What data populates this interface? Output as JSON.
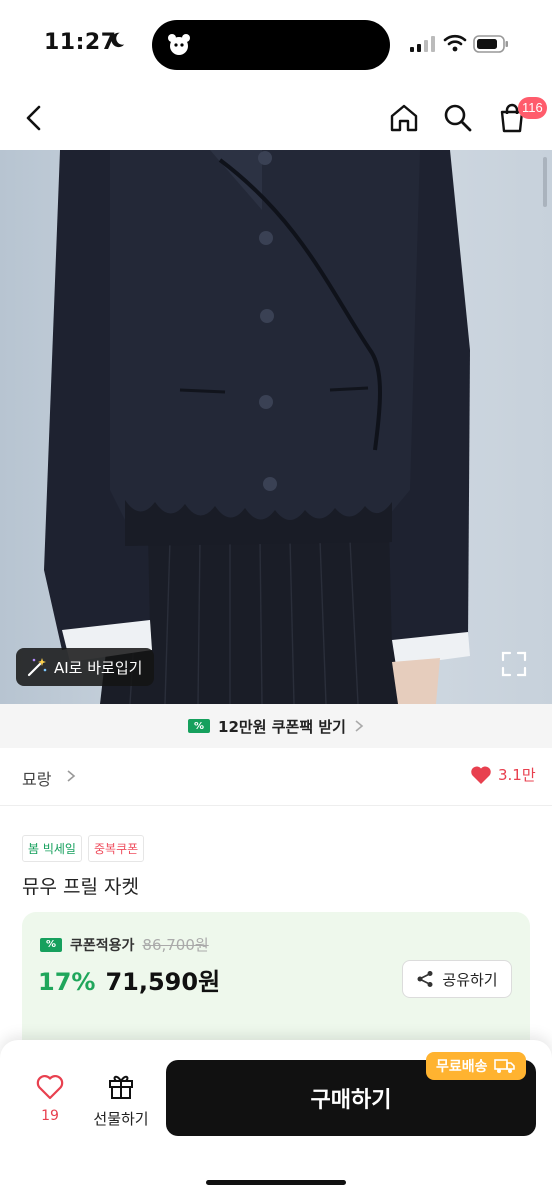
{
  "status_bar": {
    "time": "11:27"
  },
  "nav": {
    "back_icon": "chevron-left-icon",
    "home_icon": "home-icon",
    "search_icon": "search-icon",
    "cart_icon": "shopping-bag-icon",
    "cart_count": "116"
  },
  "photo": {
    "ai_fit_label": "AI로 바로입기",
    "expand_icon": "expand-icon"
  },
  "coupon_banner": {
    "text": "12만원 쿠폰팩 받기"
  },
  "brand": {
    "name": "묘랑",
    "likes": "3.1만"
  },
  "product": {
    "tags": [
      {
        "label": "봄 빅세일",
        "color": "#16a05d"
      },
      {
        "label": "중복쿠폰",
        "color": "#ef4e5e"
      }
    ],
    "title": "뮤우 프릴 자켓"
  },
  "price": {
    "coupon_label": "쿠폰적용가",
    "original_price": "86,700원",
    "discount": "17%",
    "final_price": "71,590원",
    "share_label": "공유하기"
  },
  "bottom_bar": {
    "wish_count": "19",
    "gift_label": "선물하기",
    "buy_label": "구매하기",
    "free_shipping_label": "무료배송"
  },
  "colors": {
    "accent_green": "#1fa65b",
    "accent_red": "#e8404f",
    "badge_orange": "#ffb330"
  }
}
